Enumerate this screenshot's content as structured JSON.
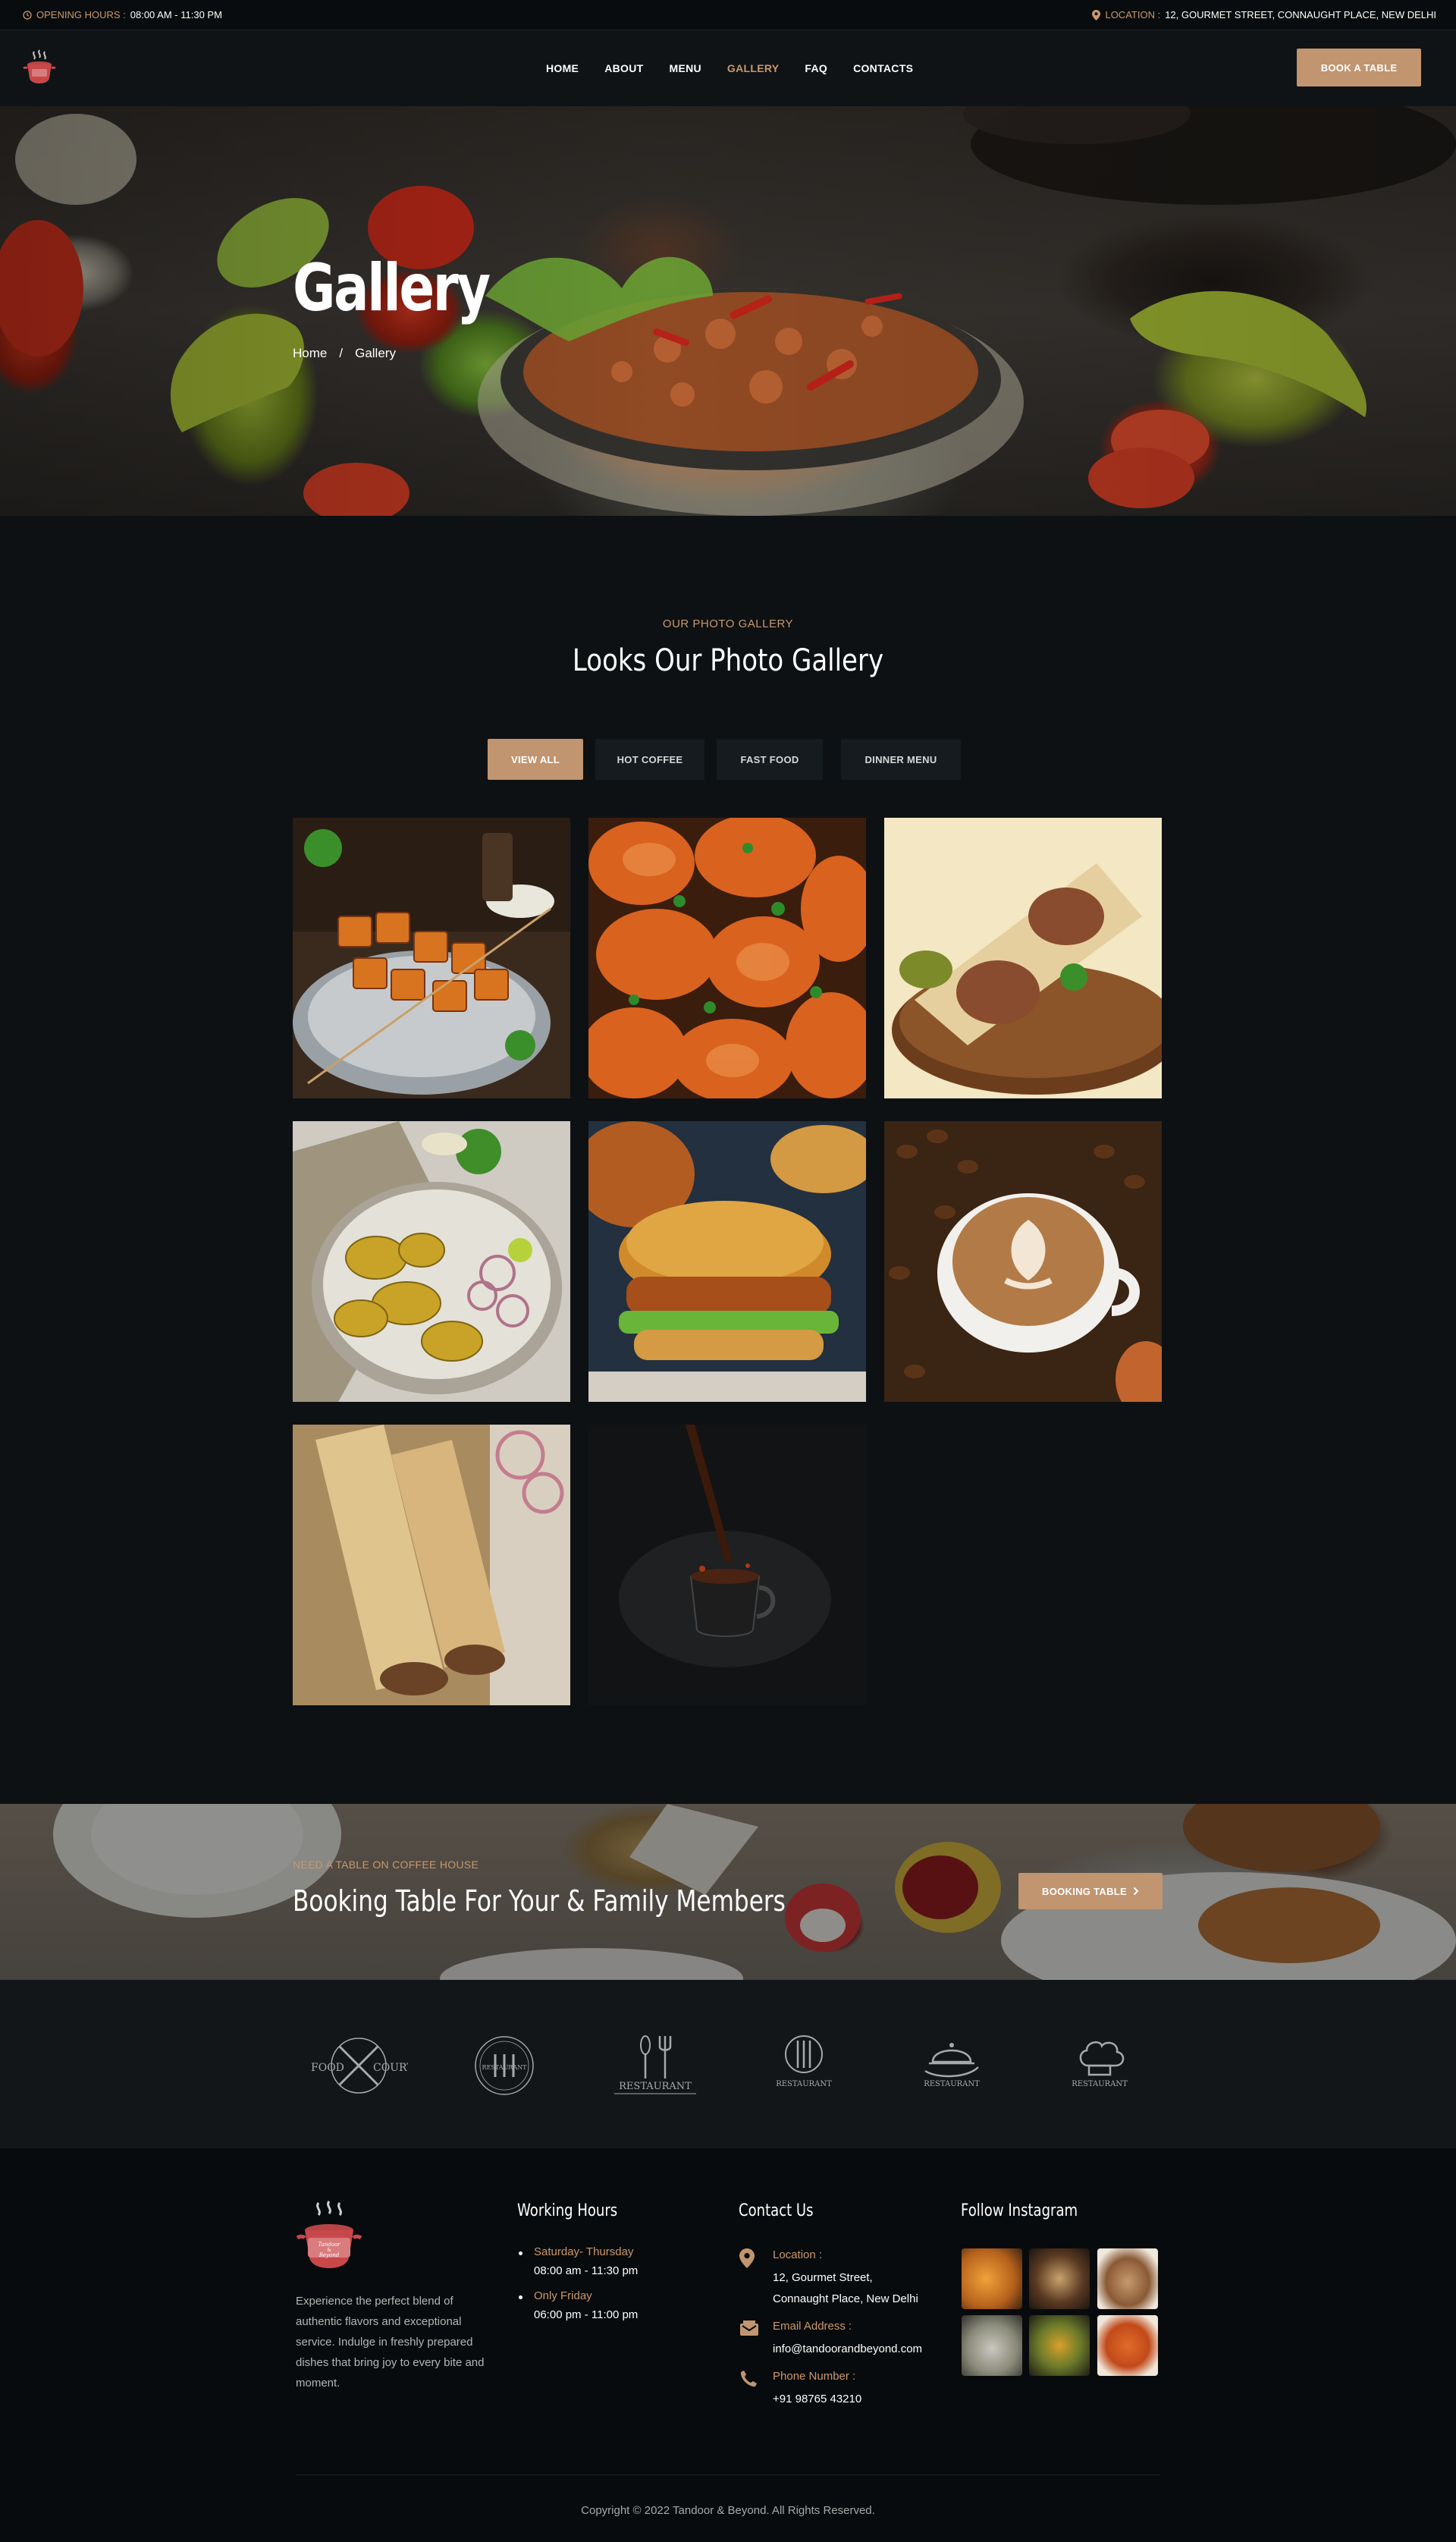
{
  "topbar": {
    "hours_label": "OPENING HOURS :",
    "hours_value": "08:00 AM - 11:30 PM",
    "location_label": "LOCATION :",
    "location_value": "12, GOURMET STREET, CONNAUGHT PLACE, NEW DELHI",
    "clock_icon": "clock-icon",
    "pin_icon": "map-pin-icon"
  },
  "header": {
    "nav": [
      "HOME",
      "ABOUT",
      "MENU",
      "GALLERY",
      "FAQ",
      "CONTACTS"
    ],
    "active_nav": "GALLERY",
    "book_button": "BOOK A TABLE"
  },
  "hero": {
    "title": "Gallery",
    "breadcrumb_home": "Home",
    "breadcrumb_sep": "/",
    "breadcrumb_current": "Gallery"
  },
  "gallery": {
    "eyebrow": "OUR PHOTO GALLERY",
    "title": "Looks Our Photo Gallery",
    "filters": [
      "VIEW ALL",
      "HOT COFFEE",
      "FAST FOOD",
      "DINNER MENU"
    ],
    "active_filter": "VIEW ALL",
    "photos": [
      "paneer tikka skewers",
      "tandoori prawns",
      "kebab wrap",
      "chicken tikka platter",
      "fried chicken burger",
      "latte art coffee",
      "kathi rolls",
      "coffee pour"
    ]
  },
  "booking": {
    "eyebrow": "NEED A TABLE ON COFFEE HOUSE",
    "title": "Booking Table For Your & Family Members",
    "button": "BOOKING TABLE"
  },
  "brands": {
    "logos": [
      {
        "icon": "food-court-logo",
        "text": "FOOD COURT"
      },
      {
        "icon": "restaurant-round-logo",
        "text": "RESTAURANT"
      },
      {
        "icon": "restaurant-cutlery-logo",
        "text": "RESTAURANT"
      },
      {
        "icon": "restaurant-plate-logo",
        "text": "RESTAURANT"
      },
      {
        "icon": "restaurant-cloche-logo",
        "text": "RESTAURANT"
      },
      {
        "icon": "restaurant-chef-hat-logo",
        "text": "RESTAURANT"
      }
    ]
  },
  "footer": {
    "logo_text": "Tandoor & Beyond",
    "about": "Experience the perfect blend of authentic flavors and exceptional service. Indulge in freshly prepared dishes that bring joy to every bite and moment.",
    "hours_title": "Working Hours",
    "hours": [
      {
        "days": "Saturday- Thursday",
        "time": "08:00 am - 11:30 pm"
      },
      {
        "days": "Only Friday",
        "time": "06:00 pm - 11:00 pm"
      }
    ],
    "contact_title": "Contact Us",
    "location_label": "Location :",
    "location_line1": "12, Gourmet Street,",
    "location_line2": "Connaught Place, New Delhi",
    "email_label": "Email Address :",
    "email_value": "info@tandoorandbeyond.com",
    "phone_label": "Phone Number :",
    "phone_value": "+91 98765 43210",
    "instagram_title": "Follow Instagram",
    "copyright": "Copyright © 2022 Tandoor & Beyond. All Rights Reserved."
  },
  "colors": {
    "accent": "#c19570",
    "accent_text": "#c9986b",
    "background": "#0d1114",
    "footer_background": "#080b0d"
  }
}
